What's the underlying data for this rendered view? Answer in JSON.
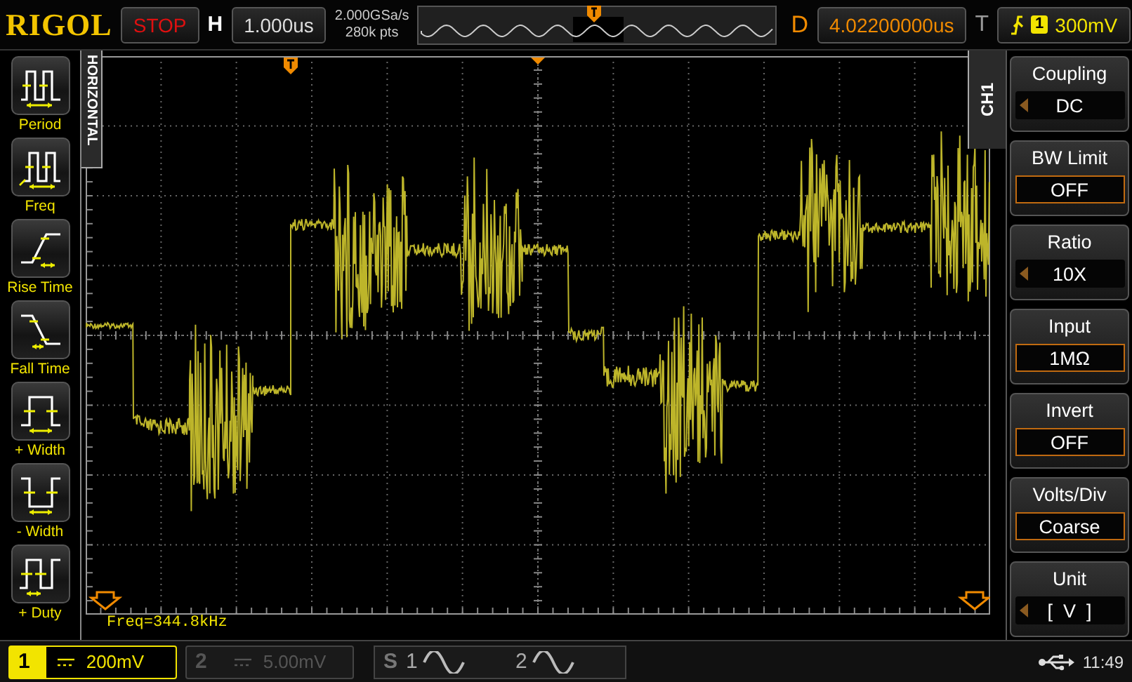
{
  "top_bar": {
    "logo": "RIGOL",
    "run_state": "STOP",
    "timebase_label": "H",
    "timebase": "1.000us",
    "sample_rate": "2.000GSa/s",
    "memory_depth": "280k pts",
    "delay_label": "D",
    "delay": "4.02200000us",
    "trigger_label": "T",
    "trigger_channel": "1",
    "trigger_level": "300mV"
  },
  "measure_panel": {
    "title": "HORIZONTAL",
    "items": [
      {
        "kind": "period",
        "label": "Period"
      },
      {
        "kind": "freq",
        "label": "Freq"
      },
      {
        "kind": "rise",
        "label": "Rise Time"
      },
      {
        "kind": "fall",
        "label": "Fall Time"
      },
      {
        "kind": "pwidth",
        "label": "+ Width"
      },
      {
        "kind": "nwidth",
        "label": "- Width"
      },
      {
        "kind": "duty",
        "label": "+ Duty"
      }
    ]
  },
  "plot": {
    "measurement": "Freq=344.8kHz"
  },
  "menu": {
    "title": "CH1",
    "items": [
      {
        "kind": "cycle",
        "label": "Coupling",
        "value": "DC"
      },
      {
        "kind": "toggle",
        "label": "BW Limit",
        "value": "OFF"
      },
      {
        "kind": "cycle",
        "label": "Ratio",
        "value": "10X"
      },
      {
        "kind": "toggle",
        "label": "Input",
        "value": "1MΩ"
      },
      {
        "kind": "toggle",
        "label": "Invert",
        "value": "OFF"
      },
      {
        "kind": "toggle",
        "label": "Volts/Div",
        "value": "Coarse"
      },
      {
        "kind": "cycle",
        "label": "Unit",
        "value": "[  V  ]"
      }
    ]
  },
  "bottom_bar": {
    "channels": [
      {
        "number": "1",
        "scale": "200mV",
        "selected": true
      },
      {
        "number": "2",
        "scale": "5.00mV",
        "selected": false
      }
    ],
    "math_label": "S",
    "math": [
      {
        "number": "1"
      },
      {
        "number": "2"
      }
    ],
    "time": "11:49"
  }
}
